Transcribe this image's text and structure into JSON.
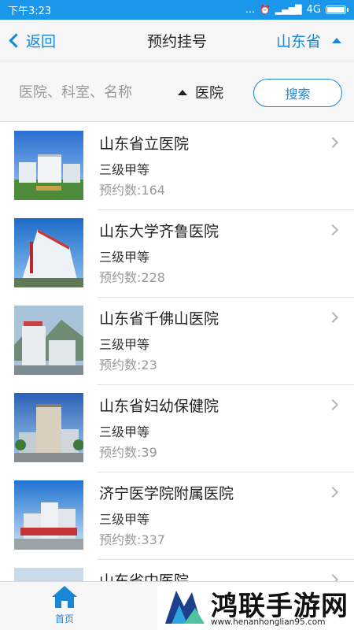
{
  "status_bar": {
    "time": "下午3:23",
    "dots": "...",
    "network": "4G",
    "icons": [
      "alarm-icon",
      "hd-signal-icon",
      "battery-icon"
    ],
    "battery_level": 0.9
  },
  "nav": {
    "back_label": "返回",
    "title": "预约挂号",
    "province": "山东省"
  },
  "search": {
    "placeholder": "医院、科室、名称",
    "filter_label": "医院",
    "button_label": "搜索"
  },
  "hospitals": [
    {
      "name": "山东省立医院",
      "level": "三级甲等",
      "appointments": "预约数:164"
    },
    {
      "name": "山东大学齐鲁医院",
      "level": "三级甲等",
      "appointments": "预约数:228"
    },
    {
      "name": "山东省千佛山医院",
      "level": "三级甲等",
      "appointments": "预约数:23"
    },
    {
      "name": "山东省妇幼保健院",
      "level": "三级甲等",
      "appointments": "预约数:39"
    },
    {
      "name": "济宁医学院附属医院",
      "level": "三级甲等",
      "appointments": "预约数:337"
    },
    {
      "name": "山东省中医院",
      "level": "",
      "appointments": ""
    }
  ],
  "tabbar": {
    "home_label": "首页"
  },
  "watermark": {
    "title": "鸿联手游网",
    "url": "www.henanhonglian95.com"
  },
  "colors": {
    "accent": "#1a86d6",
    "status_bar": "#1a96ea",
    "muted": "#999999"
  }
}
